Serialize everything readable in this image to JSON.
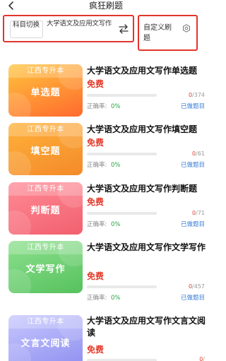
{
  "header": {
    "title": "疯狂刷题",
    "back_icon": "chevron-left-icon"
  },
  "toolbar": {
    "switch_label": "科目切换",
    "subject_name": "大学语文及应用文写作",
    "swap_icon": "swap-arrows-icon",
    "custom_label": "自定义刷题",
    "gear_icon": "gear-icon",
    "highlight_color": "#e2352b"
  },
  "items": [
    {
      "banner": "江西专升本",
      "cover_label": "单选题",
      "title": "大学语文及应用文写作单选题",
      "price": "免费",
      "done": "0",
      "total": "/374",
      "accuracy_label": "正确率:",
      "accuracy": "0%",
      "done_link": "已做题目",
      "progress": 0,
      "color_top": "#ffc53d",
      "color_bottom": "#ff6a2e"
    },
    {
      "banner": "江西专升本",
      "cover_label": "填空题",
      "title": "大学语文及应用文写作填空题",
      "price": "免费",
      "done": "0",
      "total": "/61",
      "accuracy_label": "正确率:",
      "accuracy": "0%",
      "done_link": "已做题目",
      "progress": 0,
      "color_top": "#ffb23a",
      "color_bottom": "#f48a2a"
    },
    {
      "banner": "江西专升本",
      "cover_label": "判断题",
      "title": "大学语文及应用文写作判断题",
      "price": "免费",
      "done": "0",
      "total": "/71",
      "accuracy_label": "正确率:",
      "accuracy": "0%",
      "done_link": "已做题目",
      "progress": 0,
      "color_top": "#ff8b97",
      "color_bottom": "#f2606e"
    },
    {
      "banner": "江西专升本",
      "cover_label": "文学写作",
      "title": "大学语文及应用文写作文学写作",
      "price": "免费",
      "done": "0",
      "total": "/457",
      "accuracy_label": "正确率:",
      "accuracy": "0%",
      "done_link": "已做题目",
      "progress": 0,
      "color_top": "#8de08d",
      "color_bottom": "#56c25e"
    },
    {
      "banner": "江西专升本",
      "cover_label": "文言文阅读",
      "title": "大学语文及应用文写作文言文阅读",
      "price": "免费",
      "done": "0",
      "total": "/",
      "accuracy_label": "",
      "accuracy": "",
      "done_link": "",
      "progress": 0,
      "color_top": "#c8c8ff",
      "color_bottom": "#8f8ff0"
    }
  ]
}
